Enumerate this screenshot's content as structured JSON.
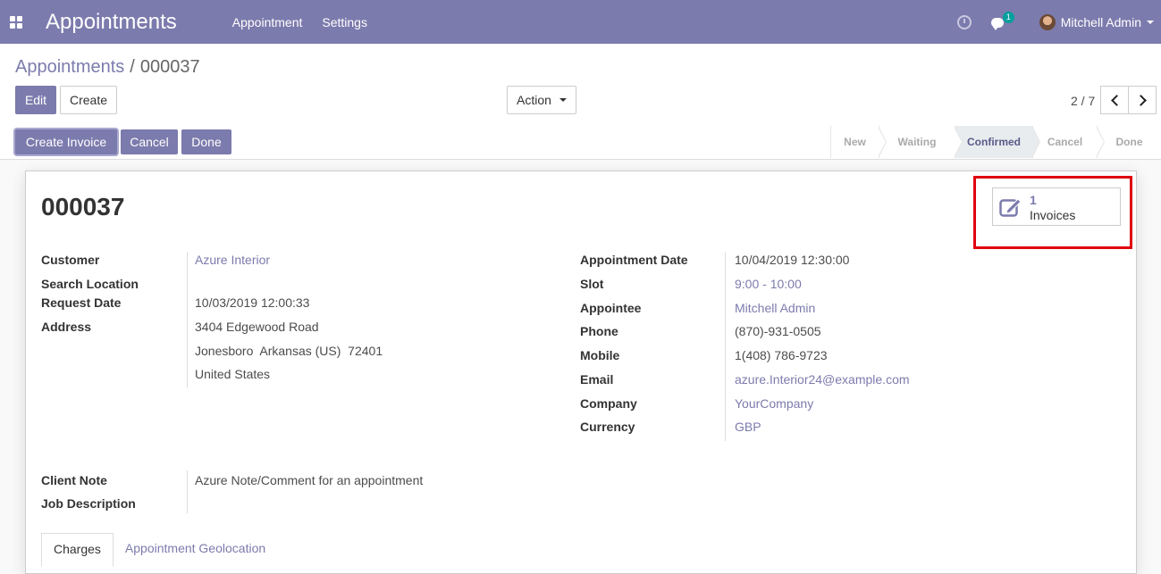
{
  "navbar": {
    "brand": "Appointments",
    "menu": [
      "Appointment",
      "Settings"
    ],
    "messages_badge": "1",
    "user_name": "Mitchell Admin",
    "icons": [
      "apps-icon",
      "clock-icon",
      "chat-icon",
      "avatar",
      "caret-down-icon"
    ]
  },
  "breadcrumb": {
    "parent": "Appointments",
    "separator": "/",
    "current": "000037"
  },
  "toolbar": {
    "edit_label": "Edit",
    "create_label": "Create",
    "action_label": "Action"
  },
  "pager": {
    "value": "2 / 7"
  },
  "statusbar": {
    "buttons": [
      "Create Invoice",
      "Cancel",
      "Done"
    ],
    "stages": [
      "New",
      "Waiting",
      "Confirmed",
      "Cancel",
      "Done"
    ],
    "active_stage": "Confirmed"
  },
  "record": {
    "title": "000037",
    "invoices_count": "1",
    "invoices_label": "Invoices"
  },
  "left_fields": {
    "customer_label": "Customer",
    "customer": "Azure Interior",
    "search_location_label": "Search Location",
    "request_date_label": "Request Date",
    "request_date": "10/03/2019 12:00:33",
    "address_label": "Address",
    "address_line1": "3404 Edgewood Road",
    "address_line2": "Jonesboro  Arkansas (US)  72401",
    "address_line3": "United States"
  },
  "right_fields": {
    "appointment_date_label": "Appointment Date",
    "appointment_date": "10/04/2019 12:30:00",
    "slot_label": "Slot",
    "slot": "9:00 - 10:00",
    "appointee_label": "Appointee",
    "appointee": "Mitchell Admin",
    "phone_label": "Phone",
    "phone": "(870)-931-0505",
    "mobile_label": "Mobile",
    "mobile": "1(408) 786-9723",
    "email_label": "Email",
    "email": "azure.Interior24@example.com",
    "company_label": "Company",
    "company": "YourCompany",
    "currency_label": "Currency",
    "currency": "GBP"
  },
  "notes": {
    "client_note_label": "Client Note",
    "client_note": "Azure Note/Comment for an appointment",
    "job_description_label": "Job Description"
  },
  "tabs": [
    "Charges",
    "Appointment Geolocation"
  ],
  "colors": {
    "brand": "#7c7bad",
    "highlight": "#e0000f",
    "badge": "#00a09d"
  }
}
